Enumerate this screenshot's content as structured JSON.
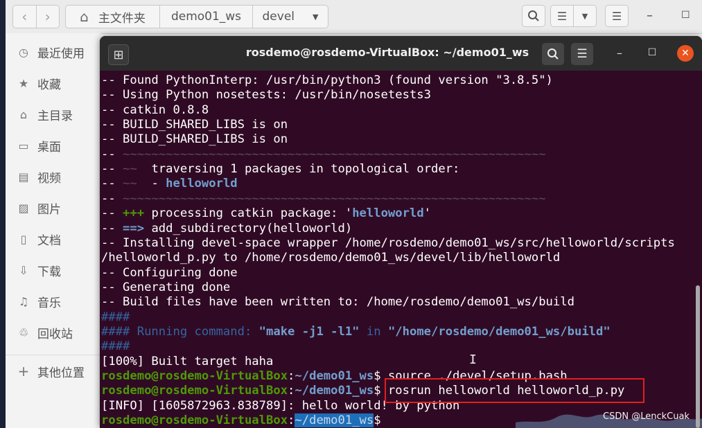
{
  "file_manager": {
    "path": [
      "主文件夹",
      "demo01_ws",
      "devel"
    ],
    "nav": {
      "back_icon": "‹",
      "forward_icon": "›",
      "home_icon": "⌂"
    },
    "sidebar": [
      {
        "icon": "clock",
        "glyph": "◷",
        "label": "最近使用"
      },
      {
        "icon": "star",
        "glyph": "★",
        "label": "收藏"
      },
      {
        "icon": "home",
        "glyph": "⌂",
        "label": "主目录"
      },
      {
        "icon": "desktop",
        "glyph": "▭",
        "label": "桌面"
      },
      {
        "icon": "video",
        "glyph": "▤",
        "label": "视频"
      },
      {
        "icon": "picture",
        "glyph": "▨",
        "label": "图片"
      },
      {
        "icon": "document",
        "glyph": "▯",
        "label": "文档"
      },
      {
        "icon": "download",
        "glyph": "⇩",
        "label": "下载"
      },
      {
        "icon": "music",
        "glyph": "♫",
        "label": "音乐"
      },
      {
        "icon": "trash",
        "glyph": "♲",
        "label": "回收站"
      },
      {
        "icon": "plus",
        "glyph": "+",
        "label": "其他位置"
      }
    ]
  },
  "terminal": {
    "title": "rosdemo@rosdemo-VirtualBox: ~/demo01_ws",
    "lines": [
      [
        {
          "t": "-- Found PythonInterp: /usr/bin/python3 (found version \"3.8.5\")"
        }
      ],
      [
        {
          "t": "-- Using Python nosetests: /usr/bin/nosetests3"
        }
      ],
      [
        {
          "t": "-- catkin 0.8.8"
        }
      ],
      [
        {
          "t": "-- BUILD_SHARED_LIBS is on"
        }
      ],
      [
        {
          "t": "-- BUILD_SHARED_LIBS is on"
        }
      ],
      [
        {
          "t": "-- "
        },
        {
          "t": "~~~~~~~~~~~~~~~~~~~~~~~~~~~~~~~~~~~~~~~~~~~~~~~~~~~~~~~~~~~",
          "c": "gr"
        }
      ],
      [
        {
          "t": "-- "
        },
        {
          "t": "~~",
          "c": "gr"
        },
        {
          "t": "  traversing 1 packages in topological order:"
        }
      ],
      [
        {
          "t": "-- "
        },
        {
          "t": "~~",
          "c": "gr"
        },
        {
          "t": "  - "
        },
        {
          "t": "helloworld",
          "c": "b"
        }
      ],
      [
        {
          "t": "-- "
        },
        {
          "t": "~~~~~~~~~~~~~~~~~~~~~~~~~~~~~~~~~~~~~~~~~~~~~~~~~~~~~~~~~~~",
          "c": "gr"
        }
      ],
      [
        {
          "t": "-- "
        },
        {
          "t": "+++",
          "c": "g"
        },
        {
          "t": " processing catkin package: '"
        },
        {
          "t": "helloworld",
          "c": "b"
        },
        {
          "t": "'"
        }
      ],
      [
        {
          "t": "-- "
        },
        {
          "t": "==>",
          "c": "b"
        },
        {
          "t": " add_subdirectory(helloworld)"
        }
      ],
      [
        {
          "t": "-- Installing devel-space wrapper /home/rosdemo/demo01_ws/src/helloworld/scripts"
        }
      ],
      [
        {
          "t": "/helloworld_p.py to /home/rosdemo/demo01_ws/devel/lib/helloworld"
        }
      ],
      [
        {
          "t": "-- Configuring done"
        }
      ],
      [
        {
          "t": "-- Generating done"
        }
      ],
      [
        {
          "t": "-- Build files have been written to: /home/rosdemo/demo01_ws/build"
        }
      ],
      [
        {
          "t": "####",
          "c": "bd"
        }
      ],
      [
        {
          "t": "#### Running command: ",
          "c": "bd"
        },
        {
          "t": "\"make -j1 -l1\"",
          "c": "b"
        },
        {
          "t": " in ",
          "c": "bd"
        },
        {
          "t": "\"/home/rosdemo/demo01_ws/build\"",
          "c": "b"
        }
      ],
      [
        {
          "t": "####",
          "c": "bd"
        }
      ],
      [
        {
          "t": "[100%] Built target haha"
        }
      ],
      [
        {
          "t": "rosdemo@rosdemo-VirtualBox",
          "c": "g"
        },
        {
          "t": ":"
        },
        {
          "t": "~/demo01_ws",
          "c": "b"
        },
        {
          "t": "$ source ./devel/setup.bash"
        }
      ],
      [
        {
          "t": "rosdemo@rosdemo-VirtualBox",
          "c": "g"
        },
        {
          "t": ":"
        },
        {
          "t": "~/demo01_ws",
          "c": "b"
        },
        {
          "t": "$ rosrun helloworld helloworld_p.py"
        }
      ],
      [
        {
          "t": "[INFO] [1605872963.838789]: hello world! by python"
        }
      ],
      [
        {
          "t": "rosdemo@rosdemo-VirtualBox",
          "c": "g"
        },
        {
          "t": ":"
        },
        {
          "t": "~/demo01_ws",
          "c": "hl"
        },
        {
          "t": "$ "
        }
      ]
    ]
  },
  "watermark": "CSDN @LenckCuak"
}
